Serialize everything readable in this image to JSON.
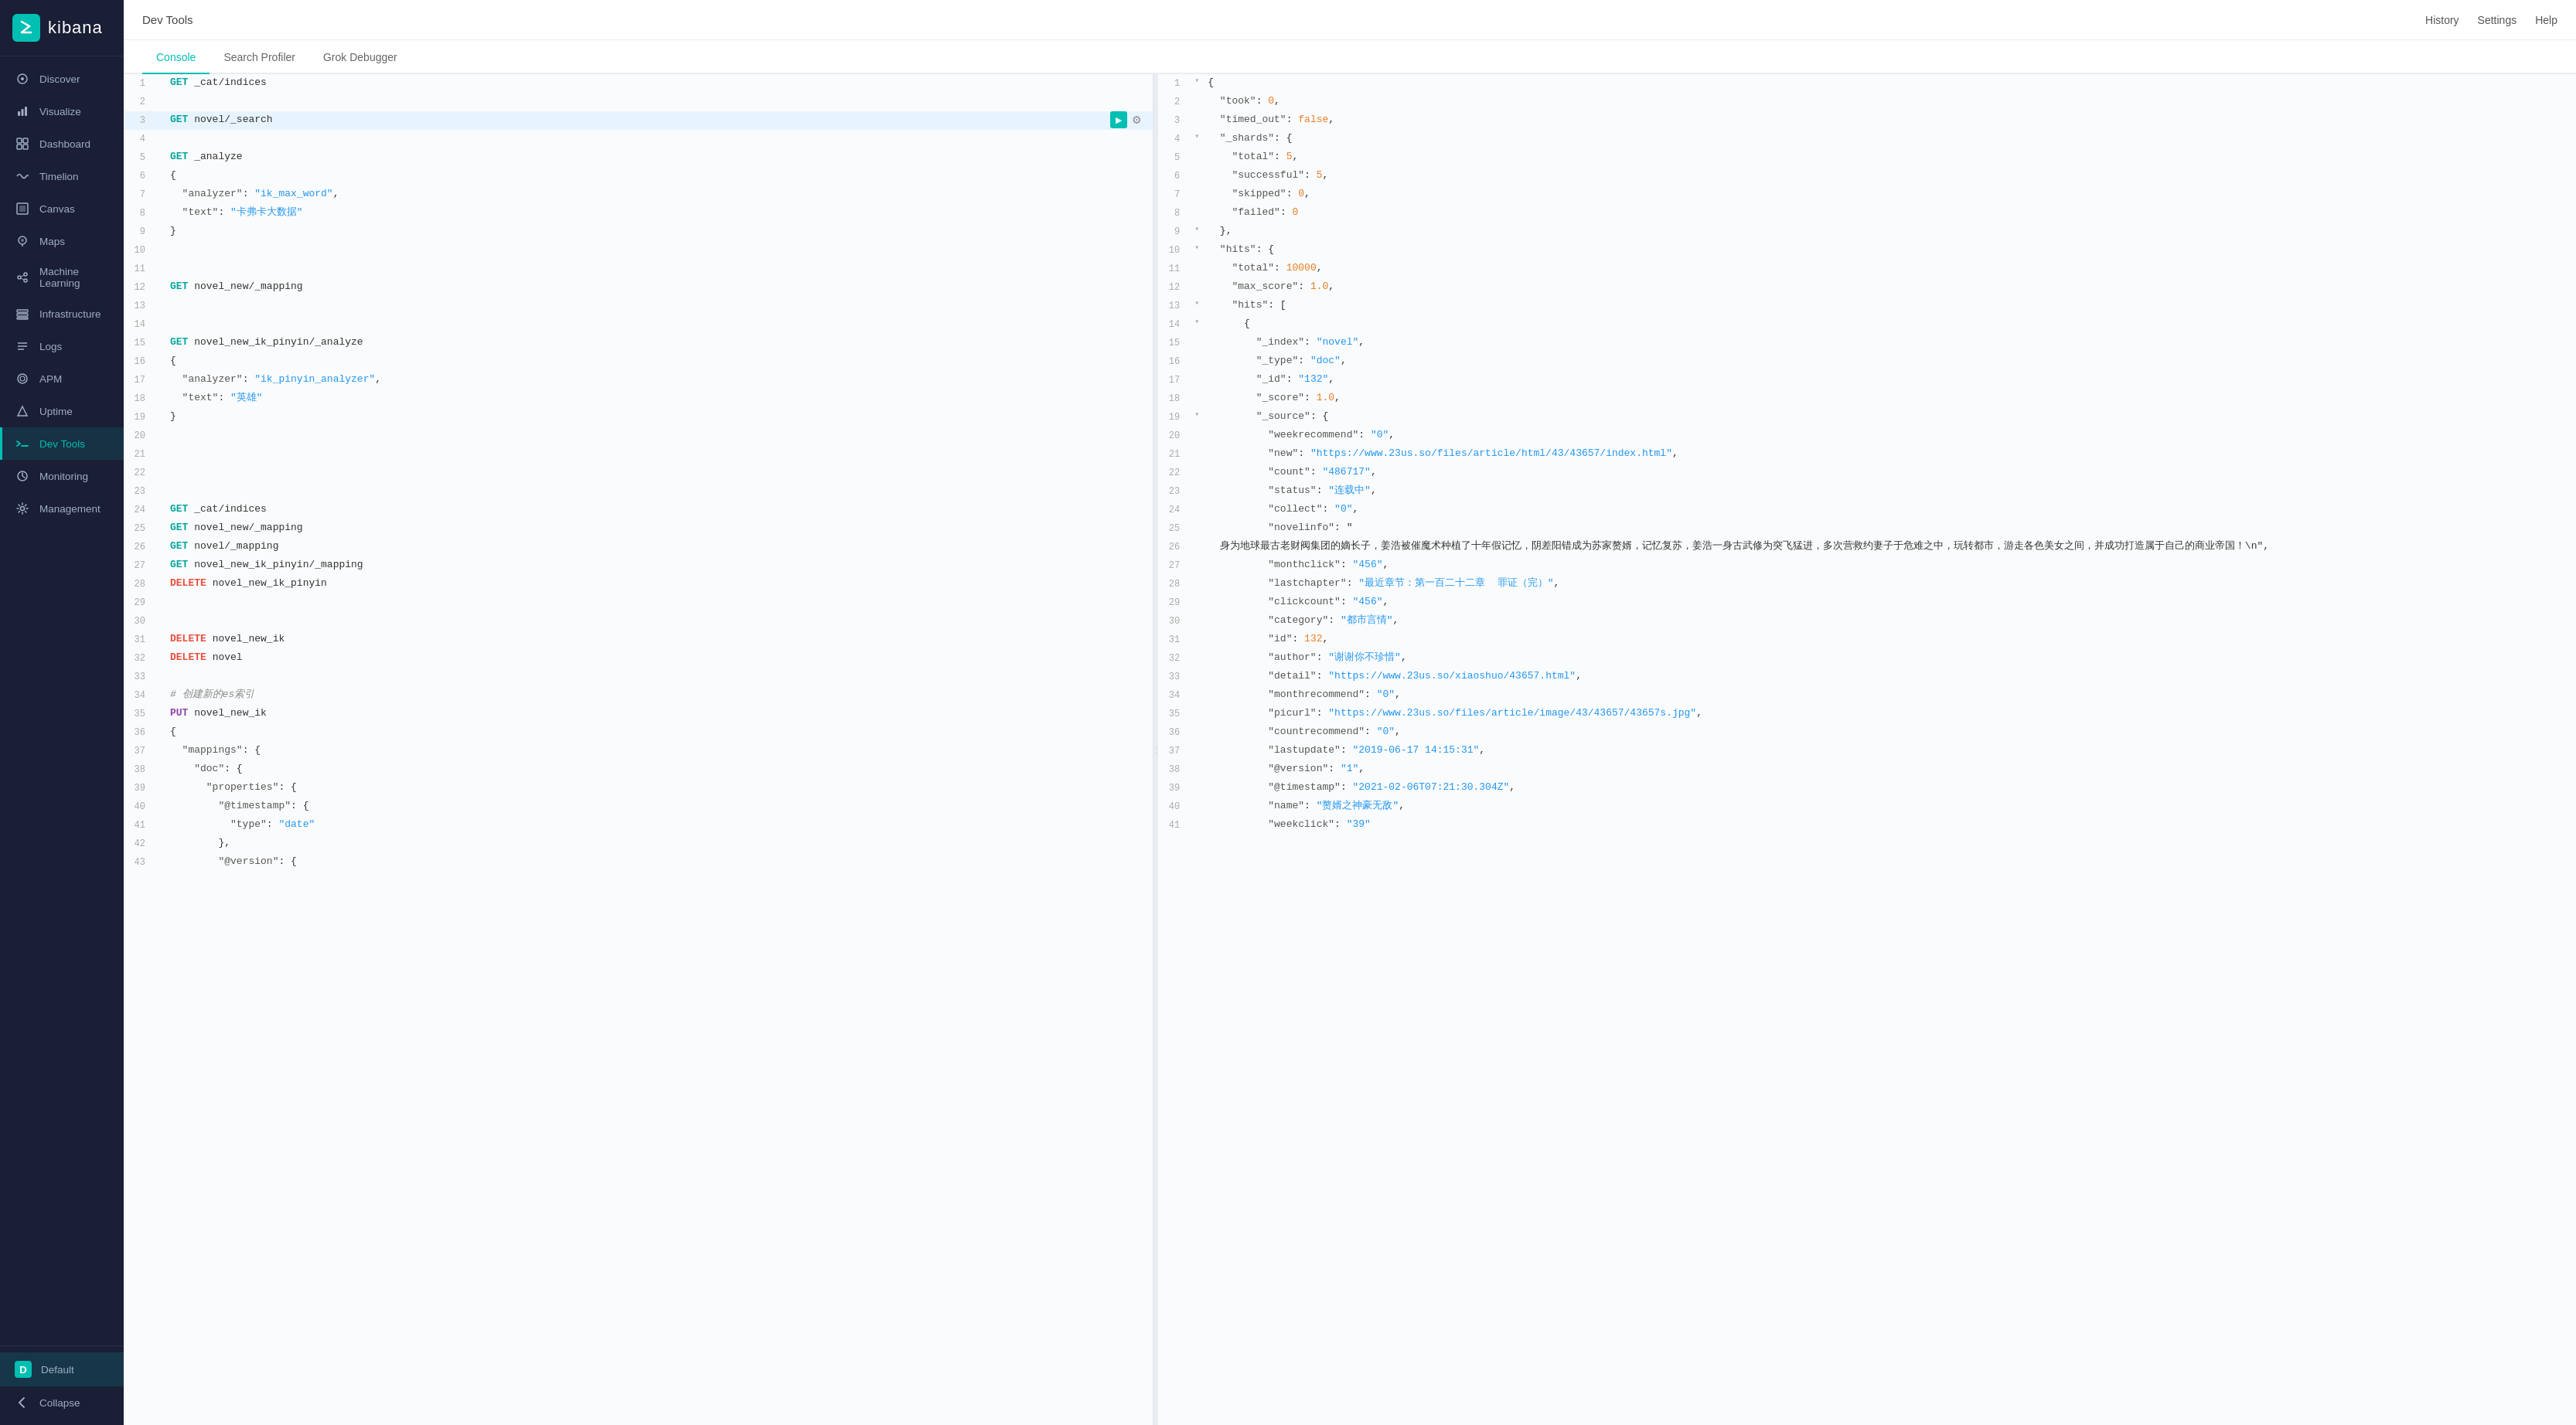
{
  "app": {
    "title": "kibana",
    "section": "Dev Tools"
  },
  "topbar": {
    "title": "Dev Tools",
    "history": "History",
    "settings": "Settings",
    "help": "Help"
  },
  "tabs": [
    {
      "id": "console",
      "label": "Console",
      "active": true
    },
    {
      "id": "search-profiler",
      "label": "Search Profiler",
      "active": false
    },
    {
      "id": "grok-debugger",
      "label": "Grok Debugger",
      "active": false
    }
  ],
  "sidebar": {
    "items": [
      {
        "id": "discover",
        "label": "Discover",
        "icon": "○"
      },
      {
        "id": "visualize",
        "label": "Visualize",
        "icon": "◈"
      },
      {
        "id": "dashboard",
        "label": "Dashboard",
        "icon": "⊞"
      },
      {
        "id": "timelion",
        "label": "Timelion",
        "icon": "〰"
      },
      {
        "id": "canvas",
        "label": "Canvas",
        "icon": "▣"
      },
      {
        "id": "maps",
        "label": "Maps",
        "icon": "⊕"
      },
      {
        "id": "ml",
        "label": "Machine Learning",
        "icon": "⚙"
      },
      {
        "id": "infra",
        "label": "Infrastructure",
        "icon": "≡"
      },
      {
        "id": "logs",
        "label": "Logs",
        "icon": "≡"
      },
      {
        "id": "apm",
        "label": "APM",
        "icon": "◎"
      },
      {
        "id": "uptime",
        "label": "Uptime",
        "icon": "▲"
      },
      {
        "id": "devtools",
        "label": "Dev Tools",
        "icon": "⌨"
      },
      {
        "id": "monitoring",
        "label": "Monitoring",
        "icon": "◉"
      },
      {
        "id": "management",
        "label": "Management",
        "icon": "⚙"
      }
    ],
    "bottom": [
      {
        "id": "default-space",
        "label": "Default",
        "icon": "D"
      },
      {
        "id": "collapse",
        "label": "Collapse",
        "icon": "◀"
      }
    ]
  },
  "console_lines": [
    {
      "num": 1,
      "content": "GET _cat/indices",
      "type": "get_cmd"
    },
    {
      "num": 2,
      "content": "",
      "type": "empty"
    },
    {
      "num": 3,
      "content": "GET novel/_search",
      "type": "get_cmd",
      "active": true
    },
    {
      "num": 4,
      "content": "",
      "type": "empty"
    },
    {
      "num": 5,
      "content": "GET _analyze",
      "type": "get_cmd"
    },
    {
      "num": 6,
      "content": "{",
      "type": "punct"
    },
    {
      "num": 7,
      "content": "  \"analyzer\" : \"ik_max_word\",",
      "type": "keyval"
    },
    {
      "num": 8,
      "content": "  \"text\" : \"卡弗卡大数据\"",
      "type": "keyval"
    },
    {
      "num": 9,
      "content": "}",
      "type": "punct"
    },
    {
      "num": 10,
      "content": "",
      "type": "empty"
    },
    {
      "num": 11,
      "content": "",
      "type": "empty"
    },
    {
      "num": 12,
      "content": "GET novel_new/_mapping",
      "type": "get_cmd"
    },
    {
      "num": 13,
      "content": "",
      "type": "empty"
    },
    {
      "num": 14,
      "content": "",
      "type": "empty"
    },
    {
      "num": 15,
      "content": "GET novel_new_ik_pinyin/_analyze",
      "type": "get_cmd"
    },
    {
      "num": 16,
      "content": "{",
      "type": "punct"
    },
    {
      "num": 17,
      "content": "  \"analyzer\": \"ik_pinyin_analyzer\",",
      "type": "keyval"
    },
    {
      "num": 18,
      "content": "  \"text\": \"英雄\"",
      "type": "keyval"
    },
    {
      "num": 19,
      "content": "}",
      "type": "punct"
    },
    {
      "num": 20,
      "content": "",
      "type": "empty"
    },
    {
      "num": 21,
      "content": "",
      "type": "empty"
    },
    {
      "num": 22,
      "content": "",
      "type": "empty"
    },
    {
      "num": 23,
      "content": "",
      "type": "empty"
    },
    {
      "num": 24,
      "content": "GET _cat/indices",
      "type": "get_cmd"
    },
    {
      "num": 25,
      "content": "GET novel_new/_mapping",
      "type": "get_cmd"
    },
    {
      "num": 26,
      "content": "GET novel/_mapping",
      "type": "get_cmd"
    },
    {
      "num": 27,
      "content": "GET novel_new_ik_pinyin/_mapping",
      "type": "get_cmd"
    },
    {
      "num": 28,
      "content": "DELETE novel_new_ik_pinyin",
      "type": "delete_cmd"
    },
    {
      "num": 29,
      "content": "",
      "type": "empty"
    },
    {
      "num": 30,
      "content": "",
      "type": "empty"
    },
    {
      "num": 31,
      "content": "DELETE novel_new_ik",
      "type": "delete_cmd"
    },
    {
      "num": 32,
      "content": "DELETE novel",
      "type": "delete_cmd"
    },
    {
      "num": 33,
      "content": "",
      "type": "empty"
    },
    {
      "num": 34,
      "content": "# 创建新的es索引",
      "type": "comment"
    },
    {
      "num": 35,
      "content": "PUT novel_new_ik",
      "type": "put_cmd"
    },
    {
      "num": 36,
      "content": "{",
      "type": "punct"
    },
    {
      "num": 37,
      "content": "  \"mappings\" : {",
      "type": "keyval"
    },
    {
      "num": 38,
      "content": "    \"doc\" : {",
      "type": "keyval"
    },
    {
      "num": 39,
      "content": "      \"properties\" : {",
      "type": "keyval"
    },
    {
      "num": 40,
      "content": "        \"@timestamp\" : {",
      "type": "keyval"
    },
    {
      "num": 41,
      "content": "          \"type\" : \"date\"",
      "type": "keyval"
    },
    {
      "num": 42,
      "content": "        },",
      "type": "punct"
    },
    {
      "num": 43,
      "content": "        \"@version\" : {",
      "type": "keyval"
    }
  ],
  "output_lines": [
    {
      "num": 1,
      "content": "{",
      "fold": true
    },
    {
      "num": 2,
      "content": "  \"took\" : 0,",
      "fold": false
    },
    {
      "num": 3,
      "content": "  \"timed_out\" : false,",
      "fold": false
    },
    {
      "num": 4,
      "content": "  \"_shards\" : {",
      "fold": true
    },
    {
      "num": 5,
      "content": "    \"total\" : 5,",
      "fold": false
    },
    {
      "num": 6,
      "content": "    \"successful\" : 5,",
      "fold": false
    },
    {
      "num": 7,
      "content": "    \"skipped\" : 0,",
      "fold": false
    },
    {
      "num": 8,
      "content": "    \"failed\" : 0",
      "fold": false
    },
    {
      "num": 9,
      "content": "  },",
      "fold": true
    },
    {
      "num": 10,
      "content": "  \"hits\" : {",
      "fold": true
    },
    {
      "num": 11,
      "content": "    \"total\" : 10000,",
      "fold": false
    },
    {
      "num": 12,
      "content": "    \"max_score\" : 1.0,",
      "fold": false
    },
    {
      "num": 13,
      "content": "    \"hits\" : [",
      "fold": true
    },
    {
      "num": 14,
      "content": "      {",
      "fold": true
    },
    {
      "num": 15,
      "content": "        \"_index\" : \"novel\",",
      "fold": false
    },
    {
      "num": 16,
      "content": "        \"_type\" : \"doc\",",
      "fold": false
    },
    {
      "num": 17,
      "content": "        \"_id\" : \"132\",",
      "fold": false
    },
    {
      "num": 18,
      "content": "        \"_score\" : 1.0,",
      "fold": false
    },
    {
      "num": 19,
      "content": "        \"_source\" : {",
      "fold": true
    },
    {
      "num": 20,
      "content": "          \"weekrecommend\" : \"0\",",
      "fold": false
    },
    {
      "num": 21,
      "content": "          \"new\" : \"https://www.23us.so/files/article/html/43/43657/index.html\",",
      "fold": false
    },
    {
      "num": 22,
      "content": "          \"count\" : \"486717\",",
      "fold": false
    },
    {
      "num": 23,
      "content": "          \"status\" : \"连载中\",",
      "fold": false
    },
    {
      "num": 24,
      "content": "          \"collect\" : \"0\",",
      "fold": false
    },
    {
      "num": 25,
      "content": "          \"novelinfo\" : \"",
      "fold": false
    },
    {
      "num": 26,
      "content": "  身为地球最古老财阀集团的嫡长子，姜浩被催魔术种植了十年假记忆，阴差阳错成为苏家赘婿，记忆复苏，姜浩一身古武修为突飞猛进，多次营救约妻子于危难之中，玩转都市，游走各色美女之间，并成功打造属于自己的商业帝国！\\n\",",
      "fold": false
    },
    {
      "num": 27,
      "content": "          \"monthclick\" : \"456\",",
      "fold": false
    },
    {
      "num": 28,
      "content": "          \"lastchapter\" : \"最近章节：第一百二十二章  罪证（完）\",",
      "fold": false
    },
    {
      "num": 29,
      "content": "          \"clickcount\" : \"456\",",
      "fold": false
    },
    {
      "num": 30,
      "content": "          \"category\" : \"都市言情\",",
      "fold": false
    },
    {
      "num": 31,
      "content": "          \"id\" : 132,",
      "fold": false
    },
    {
      "num": 32,
      "content": "          \"author\" : \"谢谢你不珍惜\",",
      "fold": false
    },
    {
      "num": 33,
      "content": "          \"detail\" : \"https://www.23us.so/xiaoshuo/43657.html\",",
      "fold": false
    },
    {
      "num": 34,
      "content": "          \"monthrecommend\" : \"0\",",
      "fold": false
    },
    {
      "num": 35,
      "content": "          \"picurl\" : \"https://www.23us.so/files/article/image/43/43657/43657s.jpg\",",
      "fold": false
    },
    {
      "num": 36,
      "content": "          \"countrecommend\" : \"0\",",
      "fold": false
    },
    {
      "num": 37,
      "content": "          \"lastupdate\" : \"2019-06-17 14:15:31\",",
      "fold": false
    },
    {
      "num": 38,
      "content": "          \"@version\" : \"1\",",
      "fold": false
    },
    {
      "num": 39,
      "content": "          \"@timestamp\" : \"2021-02-06T07:21:30.304Z\",",
      "fold": false
    },
    {
      "num": 40,
      "content": "          \"name\" : \"赘婿之神豪无敌\",",
      "fold": false
    },
    {
      "num": 41,
      "content": "          \"weekclick\" : \"39\"",
      "fold": false
    }
  ],
  "colors": {
    "brand": "#00bfb3",
    "sidebar_bg": "#1a1f36",
    "active_nav": "#00bfb3",
    "get": "#00a69c",
    "delete": "#e74c3c",
    "put": "#8e44ad",
    "string": "#2196f3",
    "number": "#e67e22",
    "key": "#555555",
    "comment": "#888888"
  }
}
